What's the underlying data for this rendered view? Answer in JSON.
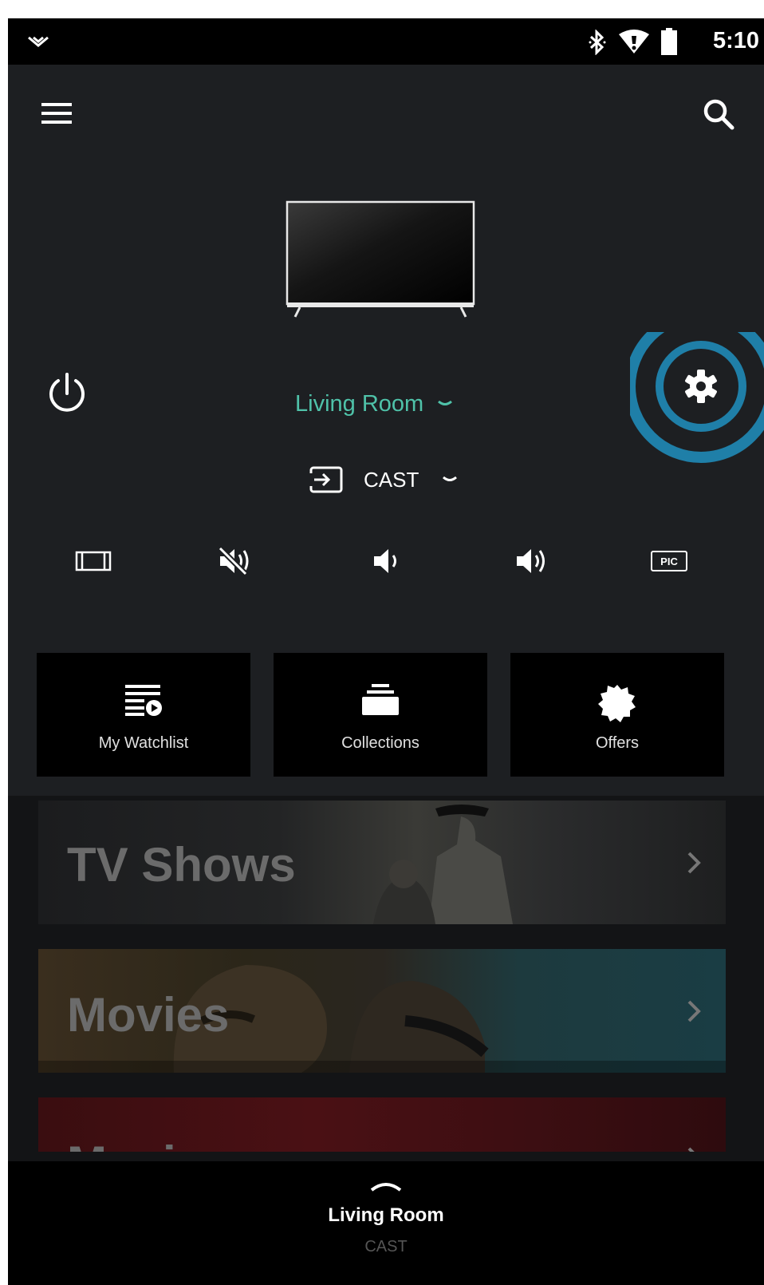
{
  "status_bar": {
    "time": "5:10",
    "icons": [
      "notification-chevron-icon",
      "bluetooth-icon",
      "wifi-icon",
      "battery-icon"
    ]
  },
  "top_bar": {
    "left_icon": "menu-icon",
    "right_icon": "search-icon"
  },
  "device": {
    "name": "Living Room",
    "input": "CAST",
    "accent_color": "#4fc2a9"
  },
  "settings": {
    "icon": "gear-icon",
    "highlight_color": "#1f7fa8"
  },
  "controls": [
    {
      "icon": "aspect-ratio-icon"
    },
    {
      "icon": "mute-icon"
    },
    {
      "icon": "volume-down-icon"
    },
    {
      "icon": "volume-up-icon"
    },
    {
      "icon": "pic-icon",
      "text": "PIC"
    }
  ],
  "tiles": [
    {
      "label": "My Watchlist",
      "icon": "watchlist-icon"
    },
    {
      "label": "Collections",
      "icon": "collections-icon"
    },
    {
      "label": "Offers",
      "icon": "offers-badge-icon"
    }
  ],
  "categories": [
    {
      "label": "TV Shows"
    },
    {
      "label": "Movies"
    },
    {
      "label": "Music"
    }
  ],
  "bottom_bar": {
    "title": "Living Room",
    "subtitle": "CAST"
  }
}
